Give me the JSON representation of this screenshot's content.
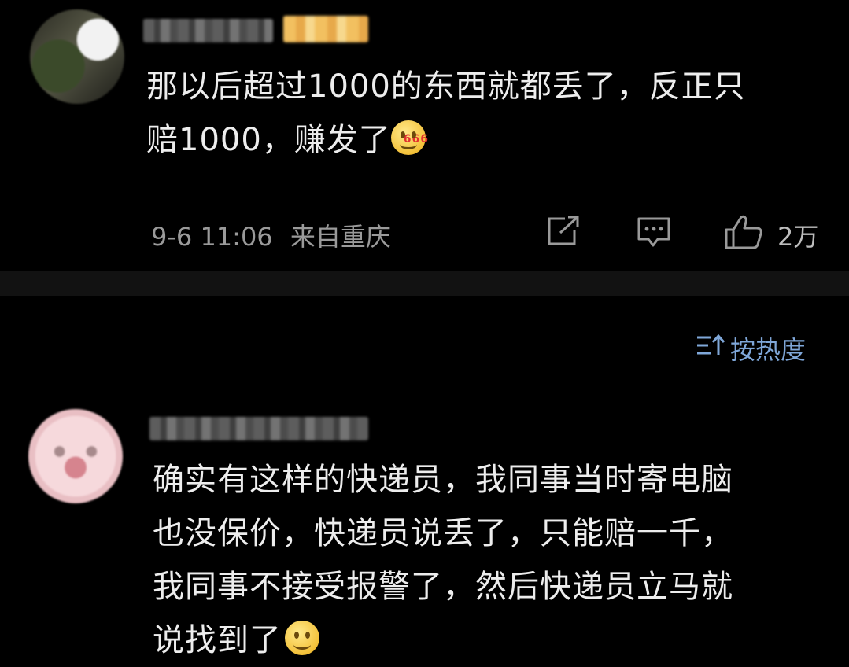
{
  "comments": [
    {
      "text_line1": "那以后超过1000的东西就都丢了，反正只",
      "text_line2": "赔1000，赚发了",
      "emoji": "666-thinking-emoji",
      "emoji_label": "666",
      "timestamp": "9-6 11:06",
      "location": "来自重庆",
      "likes": "2万"
    },
    {
      "text_lines": [
        "确实有这样的快递员，我同事当时寄电脑",
        "也没保价，快递员说丢了，只能赔一千，",
        "我同事不接受报警了，然后快递员立马就",
        "说找到了"
      ],
      "emoji": "smile-emoji"
    }
  ],
  "sort": {
    "icon": "sort-icon",
    "label": "按热度"
  },
  "colors": {
    "background": "#000000",
    "text": "#ededed",
    "meta": "#9a9a9a",
    "accent": "#7fa7d9"
  }
}
